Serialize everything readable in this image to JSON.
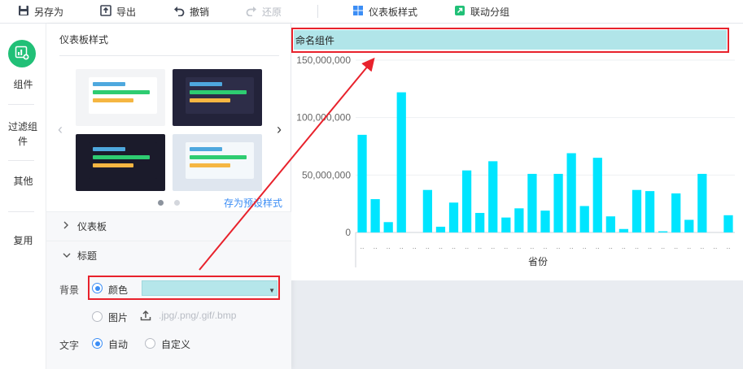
{
  "toolbar": {
    "save_as": "另存为",
    "export": "导出",
    "undo": "撤销",
    "redo": "还原",
    "dashboard_style": "仪表板样式",
    "linkage_group": "联动分组"
  },
  "sidebar": {
    "components": "组件",
    "filter": "过滤组件",
    "other": "其他",
    "reuse": "复用"
  },
  "panel": {
    "title": "仪表板样式",
    "save_preset": "存为预设样式",
    "section_dashboard": "仪表板",
    "section_title": "标题",
    "bg_label": "背景",
    "opt_color": "颜色",
    "opt_image": "图片",
    "upload_hint": ".jpg/.png/.gif/.bmp",
    "text_label": "文字",
    "opt_auto": "自动",
    "opt_custom": "自定义",
    "selected_color": "#b5e6ea"
  },
  "themes": [
    {
      "bg": "#f3f4f6",
      "card": "#ffffff"
    },
    {
      "bg": "#23233a",
      "card": "#2d2d48"
    },
    {
      "bg": "#1b1b2b",
      "card": "#1b1b2b"
    },
    {
      "bg": "#dfe6ef",
      "card": "#f4f8fb"
    }
  ],
  "theme_bar_colors": [
    "#4ea8de",
    "#2ecc71",
    "#f5b642"
  ],
  "chart_data": {
    "type": "bar",
    "title": "命名组件",
    "xlabel": "省份",
    "ylabel": "",
    "ylim": [
      0,
      150000000
    ],
    "yticks": [
      "0",
      "50,000,000",
      "100,000,000",
      "150,000,000"
    ],
    "bar_color": "#00e5ff",
    "x_tick_marker": "..",
    "values": [
      85000000,
      29000000,
      9000000,
      122000000,
      0,
      37000000,
      5000000,
      26000000,
      54000000,
      17000000,
      62000000,
      13000000,
      21000000,
      51000000,
      19000000,
      51000000,
      69000000,
      23000000,
      65000000,
      14000000,
      3000000,
      37000000,
      36000000,
      1000000,
      34000000,
      11000000,
      51000000,
      0,
      15000000
    ]
  }
}
